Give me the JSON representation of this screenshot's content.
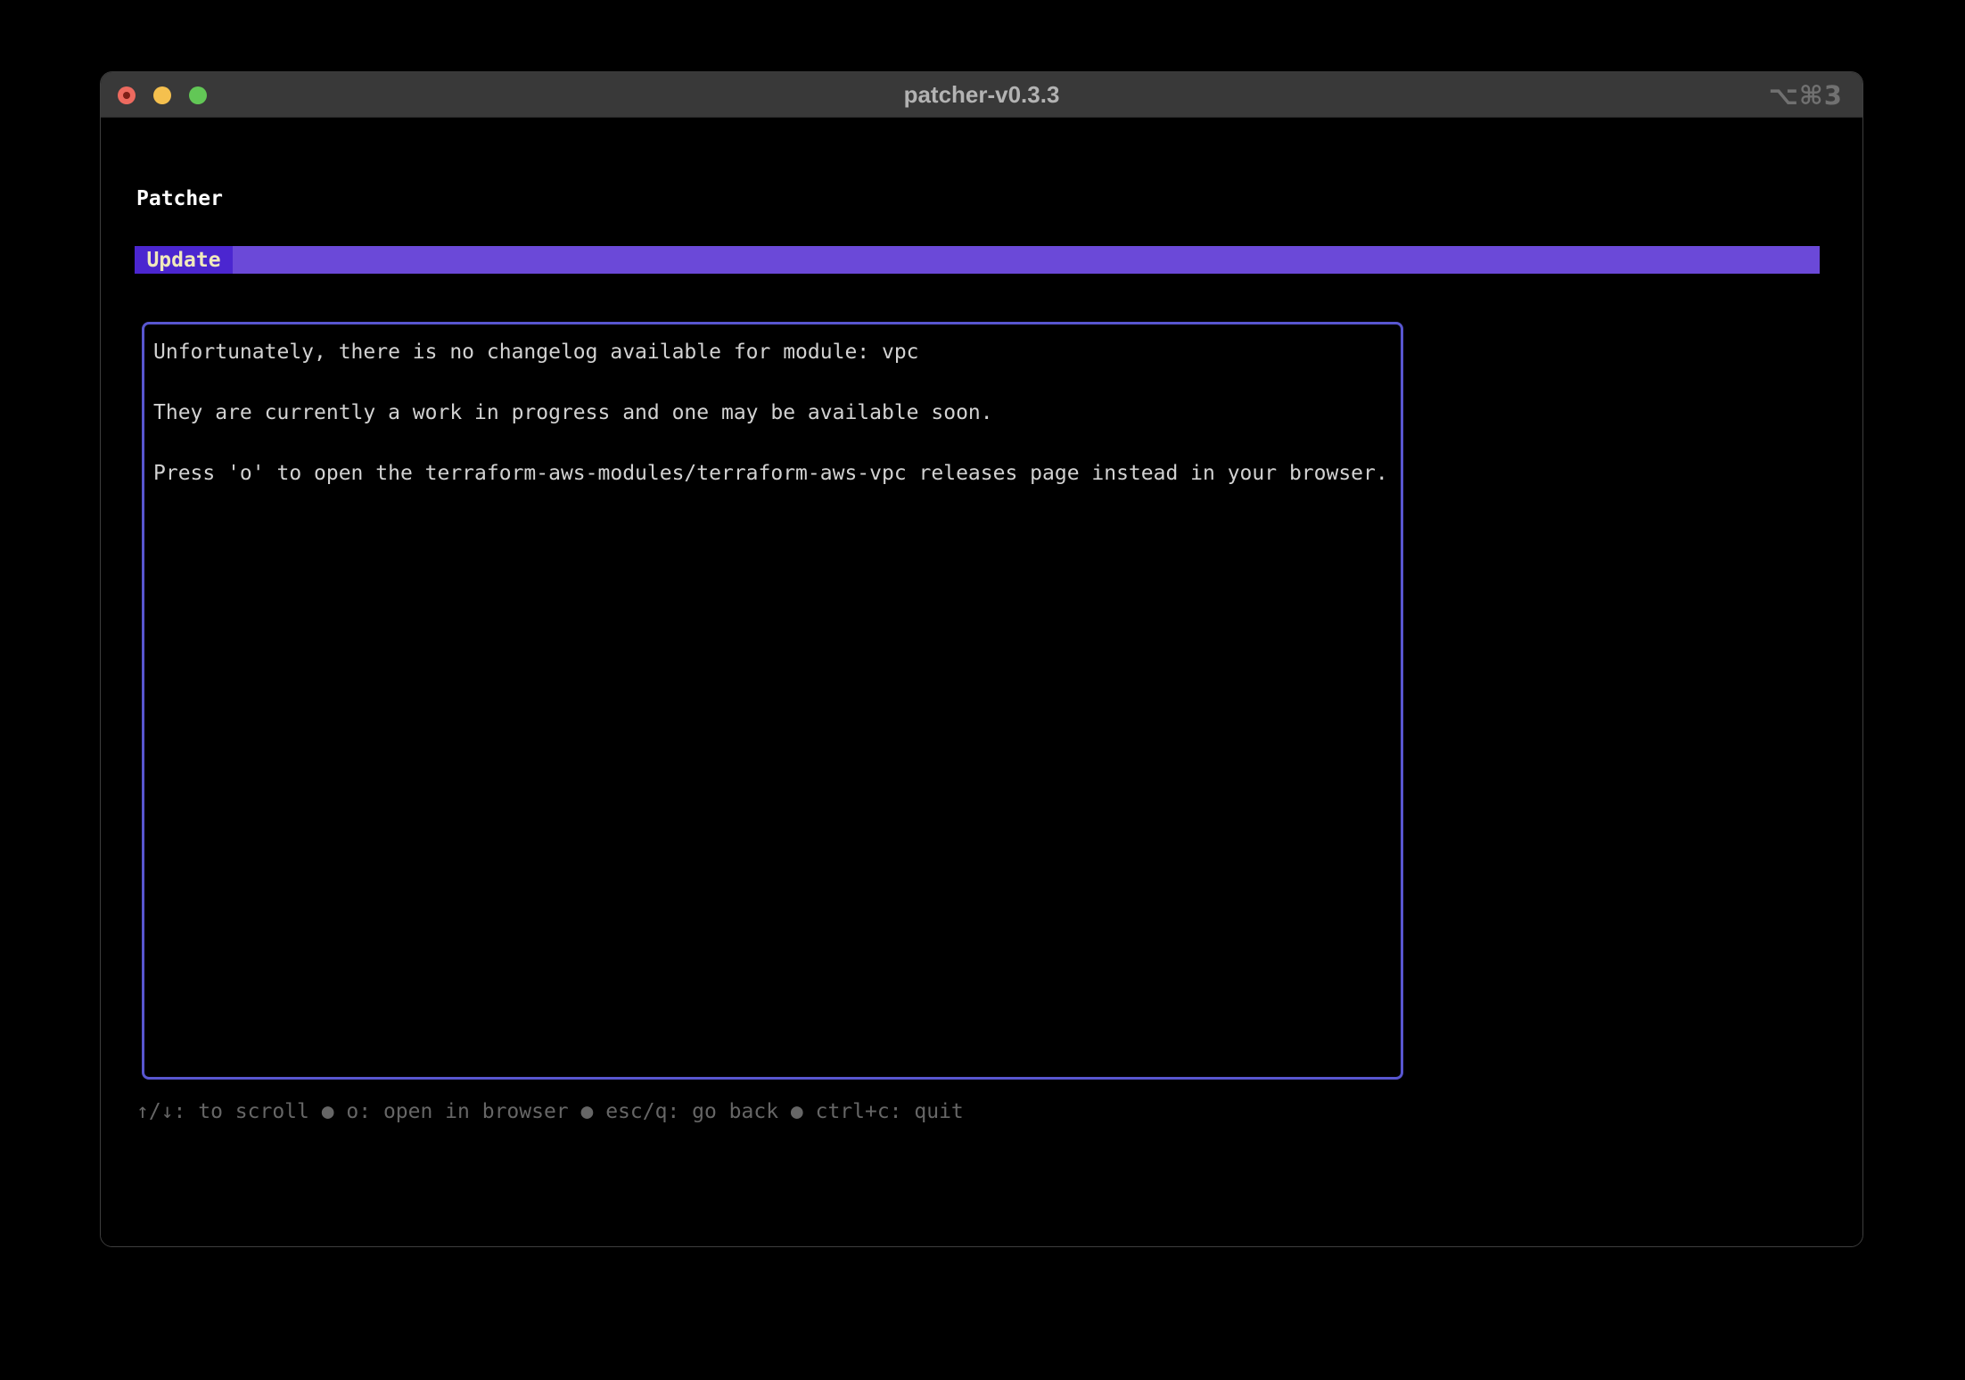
{
  "window": {
    "title": "patcher-v0.3.3",
    "tab_shortcut": "⌥⌘3",
    "titlebar_bg": "#393939",
    "traffic_lights": {
      "close": "#ed6a5f",
      "close_unsaved_dot": "#7e1f17",
      "minimize": "#f5c04e",
      "zoom": "#62c756"
    }
  },
  "app": {
    "heading": "Patcher",
    "tab_bar": {
      "tabs": [
        {
          "label": "Update",
          "active": true
        }
      ]
    },
    "changelog": {
      "lines": [
        "Unfortunately, there is no changelog available for module: vpc",
        "They are currently a work in progress and one may be available soon.",
        "Press 'o' to open the terraform-aws-modules/terraform-aws-vpc releases page instead in your browser."
      ]
    },
    "footer": {
      "separator": "●",
      "items": [
        "↑/↓: to scroll",
        "o: open in browser",
        "esc/q: go back",
        "ctrl+c: quit"
      ]
    },
    "colors": {
      "tab_bar_bg": "#6b49d8",
      "tab_active_bg": "#4b26d0",
      "tab_label": "#f0e9bc",
      "panel_border": "#5856d0",
      "body_text": "#d2d2d2",
      "heading_text": "#ffffff",
      "footer_text": "#666666",
      "terminal_bg": "#000000"
    }
  }
}
